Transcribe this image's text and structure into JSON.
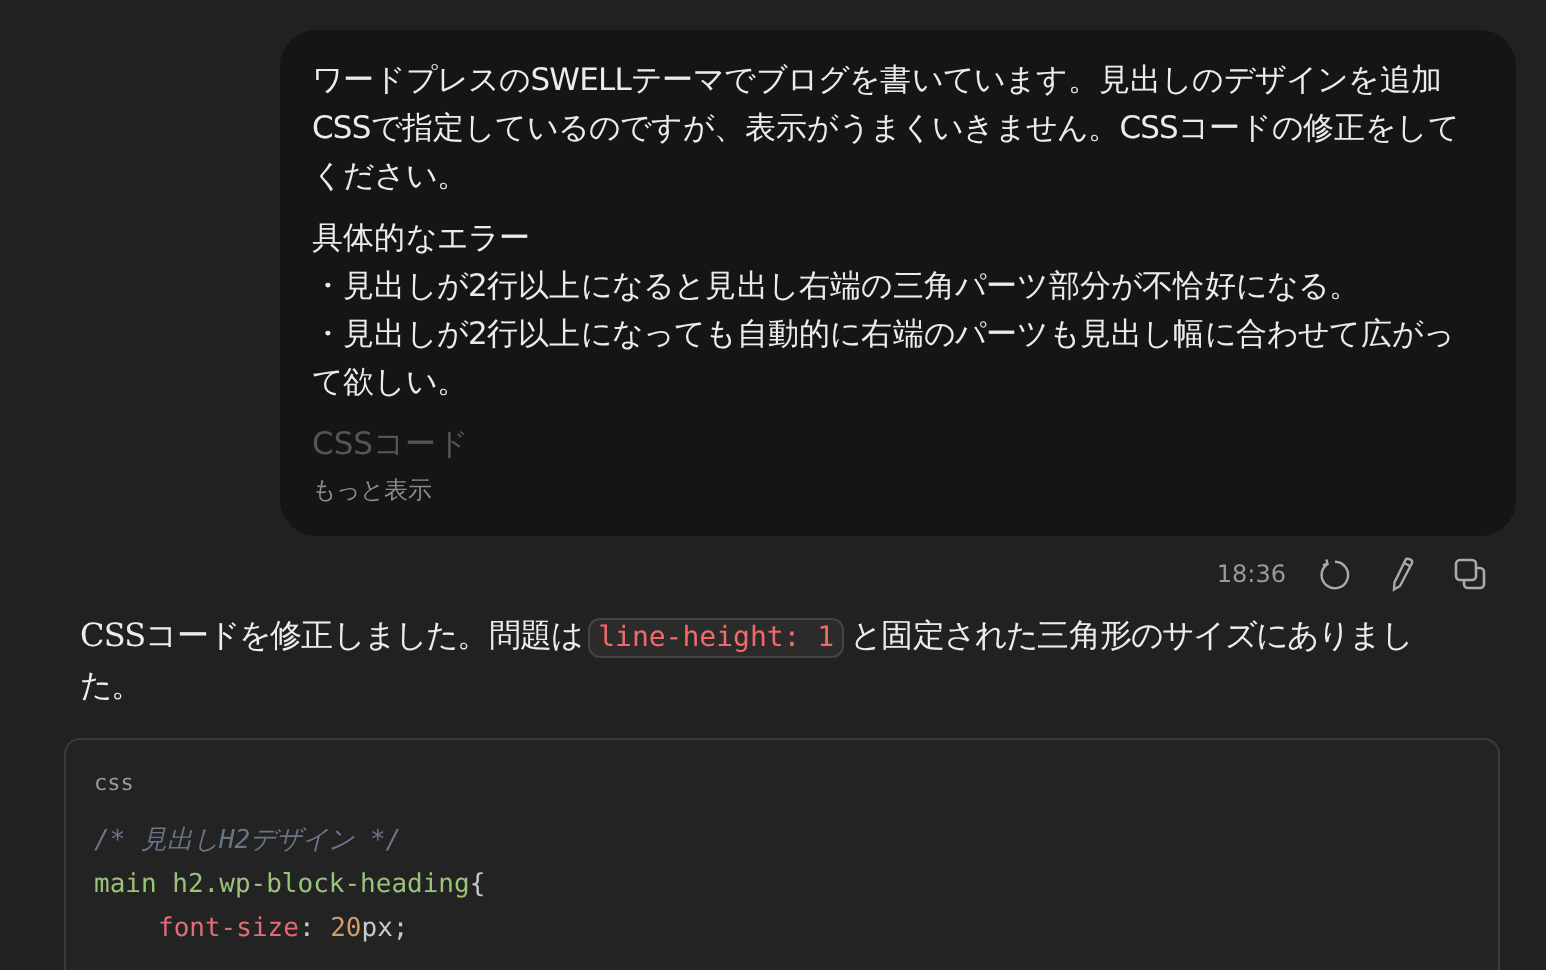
{
  "user_message": {
    "paragraphs": [
      [
        "ワードプレスのSWELLテーマでブログを書いています。見出しのデザインを追加CSSで指定しているのですが、表示がうまくいきません。CSSコードの修正をしてください。"
      ],
      [
        "具体的なエラー",
        "・見出しが2行以上になると見出し右端の三角パーツ部分が不恰好になる。",
        "・見出しが2行以上になっても自動的に右端のパーツも見出し幅に合わせて広がって欲しい。"
      ]
    ],
    "faded_text": "CSSコード",
    "show_more": "もっと表示"
  },
  "message_meta": {
    "time": "18:36"
  },
  "assistant_message": {
    "parts": [
      {
        "kind": "text",
        "text": "CSSコードを修正しました。問題は"
      },
      {
        "kind": "code",
        "text": "line-height: 1"
      },
      {
        "kind": "text",
        "text": "と固定された三角形のサイズにありました。"
      }
    ]
  },
  "code_block": {
    "language": "css",
    "lines": [
      {
        "tokens": [
          {
            "kind": "comment",
            "text": "/* 見出しH2デザイン */"
          }
        ]
      },
      {
        "tokens": [
          {
            "kind": "selector",
            "text": "main h2.wp-block-heading"
          },
          {
            "kind": "punct",
            "text": "{"
          }
        ],
        "children": [
          {
            "tokens": [
              {
                "kind": "property",
                "text": "font-size"
              },
              {
                "kind": "punct",
                "text": ": "
              },
              {
                "kind": "number",
                "text": "20"
              },
              {
                "kind": "plain",
                "text": "px;"
              }
            ]
          }
        ]
      }
    ]
  }
}
